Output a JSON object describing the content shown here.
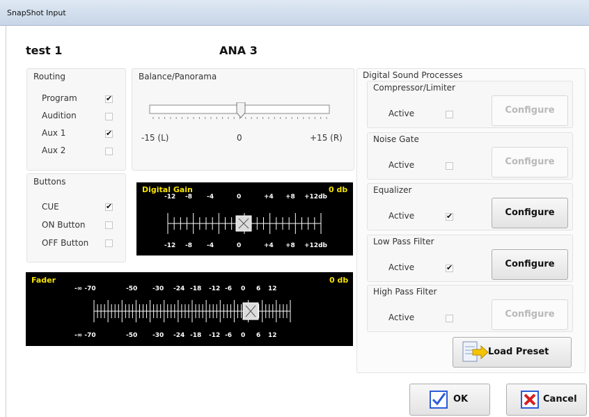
{
  "window": {
    "title": "SnapShot Input"
  },
  "header": {
    "left": "test 1",
    "center": "ANA 3"
  },
  "routing": {
    "title": "Routing",
    "items": [
      {
        "label": "Program",
        "checked": true
      },
      {
        "label": "Audition",
        "checked": false
      },
      {
        "label": "Aux 1",
        "checked": true
      },
      {
        "label": "Aux 2",
        "checked": false
      }
    ]
  },
  "balance": {
    "title": "Balance/Panorama",
    "left": "-15 (L)",
    "center": "0",
    "right": "+15 (R)",
    "value": 0
  },
  "buttons": {
    "title": "Buttons",
    "items": [
      {
        "label": "CUE",
        "checked": true
      },
      {
        "label": "ON Button",
        "checked": false
      },
      {
        "label": "OFF Button",
        "checked": false
      }
    ]
  },
  "digital_gain": {
    "title": "Digital Gain",
    "value": "0 db",
    "ticks": [
      "-12",
      "-8",
      "-4",
      "0",
      "+4",
      "+8",
      "+12db"
    ]
  },
  "fader": {
    "title": "Fader",
    "value": "0 db",
    "ticks": [
      "-∞ -70",
      "-50",
      "-30",
      "-24",
      "-18",
      "-12",
      "-6",
      "0",
      "6",
      "12"
    ]
  },
  "dsp": {
    "title": "Digital Sound Processes",
    "active_label": "Active",
    "configure_label": "Configure",
    "items": [
      {
        "title": "Compressor/Limiter",
        "active": false
      },
      {
        "title": "Noise Gate",
        "active": false
      },
      {
        "title": "Equalizer",
        "active": true
      },
      {
        "title": "Low Pass Filter",
        "active": true
      },
      {
        "title": "High Pass Filter",
        "active": false
      }
    ]
  },
  "actions": {
    "load_preset": "Load Preset",
    "ok": "OK",
    "cancel": "Cancel"
  }
}
